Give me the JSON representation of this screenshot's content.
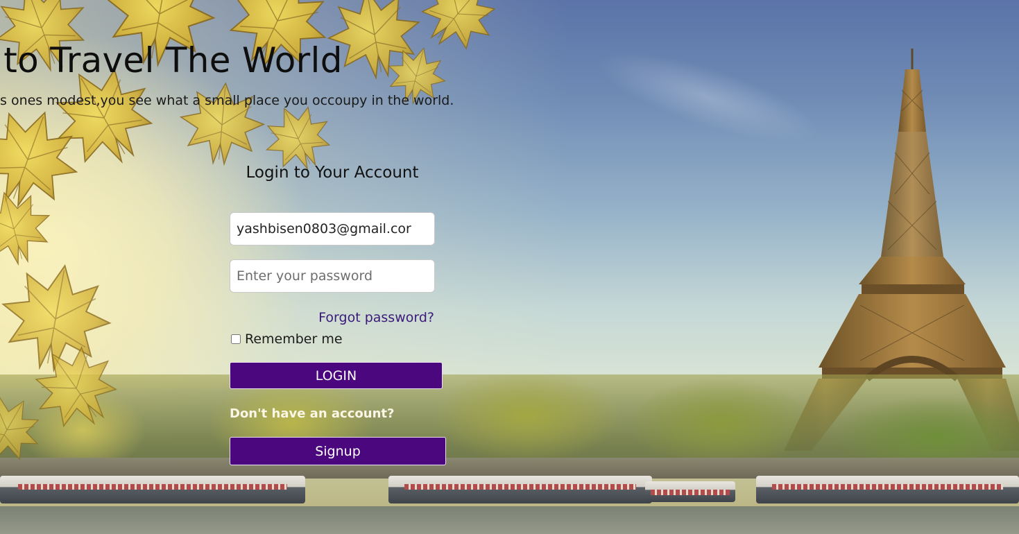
{
  "hero": {
    "title": "e to Travel The World",
    "subtitle": "kes ones modest,you see what a small place you occoupy in the world."
  },
  "login": {
    "heading": "Login to Your Account",
    "email_value": "yashbisen0803@gmail.cor",
    "password_placeholder": "Enter your password",
    "forgot_label": "Forgot password?",
    "remember_label": "Remember me",
    "remember_checked": false,
    "login_button": "LOGIN",
    "no_account_text": "Don't have an account?",
    "signup_button": "Signup"
  },
  "colors": {
    "button_bg": "#4b077e",
    "link": "#3a1a7a"
  },
  "icons": {
    "background": "eiffel-tower-scene"
  }
}
